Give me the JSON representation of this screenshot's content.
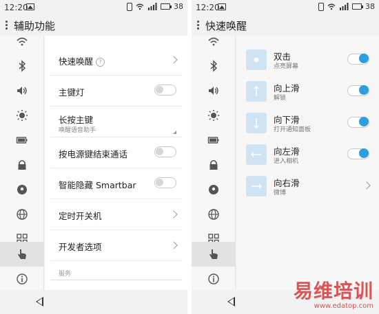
{
  "status": {
    "time": "12:20",
    "battery": "38"
  },
  "left": {
    "title": "辅助功能",
    "rows": [
      {
        "label": "快速唤醒",
        "help": "?"
      },
      {
        "label": "主键灯",
        "toggle": false
      },
      {
        "label": "长按主键",
        "sub": "唤醒语音助手"
      },
      {
        "label": "按电源键结束通话",
        "toggle": false
      },
      {
        "label": "智能隐藏 Smartbar",
        "toggle": false
      },
      {
        "label": "定时开关机"
      },
      {
        "label": "开发者选项"
      }
    ],
    "section": "服务"
  },
  "right": {
    "title": "快速唤醒",
    "gestures": [
      {
        "title": "双击",
        "sub": "点亮屏幕",
        "icon": "double-tap-icon",
        "toggle": true
      },
      {
        "title": "向上滑",
        "sub": "解锁",
        "icon": "swipe-up-icon",
        "toggle": true
      },
      {
        "title": "向下滑",
        "sub": "打开通知面板",
        "icon": "swipe-down-icon",
        "toggle": true
      },
      {
        "title": "向左滑",
        "sub": "进入相机",
        "icon": "swipe-left-icon",
        "toggle": true
      },
      {
        "title": "向右滑",
        "sub": "微博",
        "icon": "swipe-right-icon"
      }
    ]
  },
  "sidebar_icons": [
    "wifi-icon",
    "bluetooth-icon",
    "volume-icon",
    "brightness-icon",
    "battery-icon",
    "lock-icon",
    "location-icon",
    "globe-icon",
    "apps-grid-icon",
    "hand-pointer-icon",
    "info-icon"
  ],
  "watermark": {
    "big": "易维培训",
    "small": "www.edatop.com"
  },
  "colors": {
    "accent": "#2d9ee0",
    "gesture_icon_bg": "#cfe3f2"
  }
}
